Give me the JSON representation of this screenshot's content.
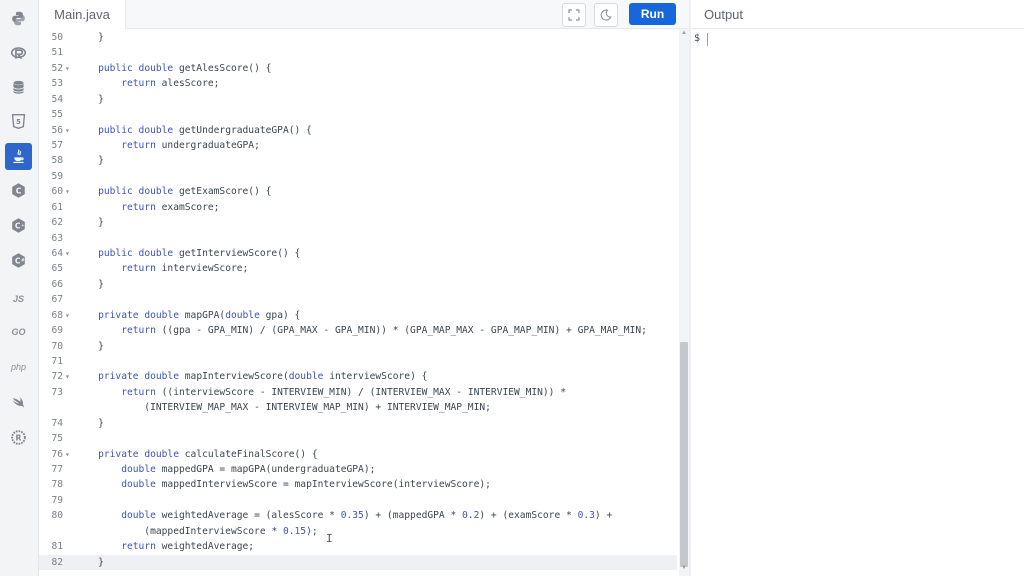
{
  "tab": {
    "filename": "Main.java"
  },
  "toolbar": {
    "run_label": "Run"
  },
  "output": {
    "title": "Output",
    "prompt": "$"
  },
  "sidebar": {
    "languages": [
      {
        "icon": "python-icon"
      },
      {
        "icon": "r-icon"
      },
      {
        "icon": "database-icon"
      },
      {
        "icon": "html5-icon"
      },
      {
        "icon": "java-icon",
        "active": true
      },
      {
        "icon": "c-icon"
      },
      {
        "icon": "cpp-icon"
      },
      {
        "icon": "csharp-icon"
      },
      {
        "icon": "js-icon",
        "text": "JS"
      },
      {
        "icon": "go-icon",
        "text": "GO"
      },
      {
        "icon": "php-icon",
        "text": "php"
      },
      {
        "icon": "swift-icon"
      },
      {
        "icon": "rust-icon"
      }
    ]
  },
  "editor": {
    "lines": [
      {
        "n": "50",
        "fold": false,
        "text": "    }"
      },
      {
        "n": "51",
        "fold": false,
        "text": ""
      },
      {
        "n": "52",
        "fold": true,
        "text": "    public double getAlesScore() {"
      },
      {
        "n": "53",
        "fold": false,
        "text": "        return alesScore;"
      },
      {
        "n": "54",
        "fold": false,
        "text": "    }"
      },
      {
        "n": "55",
        "fold": false,
        "text": ""
      },
      {
        "n": "56",
        "fold": true,
        "text": "    public double getUndergraduateGPA() {"
      },
      {
        "n": "57",
        "fold": false,
        "text": "        return undergraduateGPA;"
      },
      {
        "n": "58",
        "fold": false,
        "text": "    }"
      },
      {
        "n": "59",
        "fold": false,
        "text": ""
      },
      {
        "n": "60",
        "fold": true,
        "text": "    public double getExamScore() {"
      },
      {
        "n": "61",
        "fold": false,
        "text": "        return examScore;"
      },
      {
        "n": "62",
        "fold": false,
        "text": "    }"
      },
      {
        "n": "63",
        "fold": false,
        "text": ""
      },
      {
        "n": "64",
        "fold": true,
        "text": "    public double getInterviewScore() {"
      },
      {
        "n": "65",
        "fold": false,
        "text": "        return interviewScore;"
      },
      {
        "n": "66",
        "fold": false,
        "text": "    }"
      },
      {
        "n": "67",
        "fold": false,
        "text": ""
      },
      {
        "n": "68",
        "fold": true,
        "text": "    private double mapGPA(double gpa) {"
      },
      {
        "n": "69",
        "fold": false,
        "text": "        return ((gpa - GPA_MIN) / (GPA_MAX - GPA_MIN)) * (GPA_MAP_MAX - GPA_MAP_MIN) + GPA_MAP_MIN;"
      },
      {
        "n": "70",
        "fold": false,
        "text": "    }"
      },
      {
        "n": "71",
        "fold": false,
        "text": ""
      },
      {
        "n": "72",
        "fold": true,
        "text": "    private double mapInterviewScore(double interviewScore) {"
      },
      {
        "n": "73",
        "fold": false,
        "text": "        return ((interviewScore - INTERVIEW_MIN) / (INTERVIEW_MAX - INTERVIEW_MIN)) *"
      },
      {
        "n": "",
        "fold": false,
        "text": "            (INTERVIEW_MAP_MAX - INTERVIEW_MAP_MIN) + INTERVIEW_MAP_MIN;"
      },
      {
        "n": "74",
        "fold": false,
        "text": "    }"
      },
      {
        "n": "75",
        "fold": false,
        "text": ""
      },
      {
        "n": "76",
        "fold": true,
        "text": "    private double calculateFinalScore() {"
      },
      {
        "n": "77",
        "fold": false,
        "text": "        double mappedGPA = mapGPA(undergraduateGPA);"
      },
      {
        "n": "78",
        "fold": false,
        "text": "        double mappedInterviewScore = mapInterviewScore(interviewScore);"
      },
      {
        "n": "79",
        "fold": false,
        "text": ""
      },
      {
        "n": "80",
        "fold": false,
        "text": "        double weightedAverage = (alesScore * 0.35) + (mappedGPA * 0.2) + (examScore * 0.3) +"
      },
      {
        "n": "",
        "fold": false,
        "text": "            (mappedInterviewScore * 0.15);"
      },
      {
        "n": "81",
        "fold": false,
        "text": "        return weightedAverage;"
      },
      {
        "n": "82",
        "fold": false,
        "text": "    }",
        "current": true
      }
    ]
  },
  "colors": {
    "accent": "#1667d9",
    "keyword": "#3d54b8",
    "text": "#3c4650",
    "gutter": "#7a818a"
  }
}
